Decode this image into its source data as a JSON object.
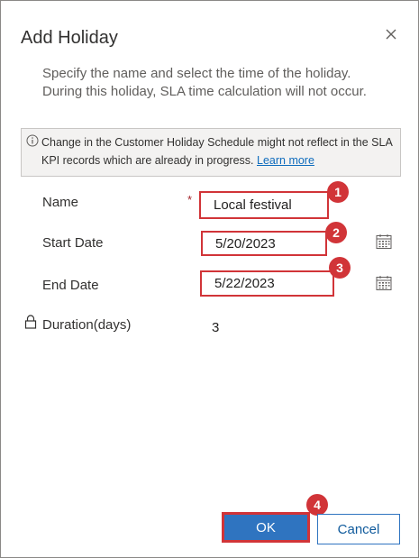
{
  "dialog": {
    "title": "Add Holiday",
    "description": "Specify the name and select the time of the holiday. During this holiday, SLA time calculation will not occur.",
    "info": {
      "text": "Change in the Customer Holiday Schedule might not reflect in the SLA KPI records which are already in progress. ",
      "link": "Learn more",
      "icon": "info-icon"
    }
  },
  "form": {
    "name": {
      "label": "Name",
      "required_marker": "*",
      "value": "Local festival"
    },
    "start_date": {
      "label": "Start Date",
      "value": "5/20/2023",
      "icon": "calendar-icon"
    },
    "end_date": {
      "label": "End Date",
      "value": "5/22/2023",
      "icon": "calendar-icon"
    },
    "duration": {
      "label": "Duration(days)",
      "value": "3",
      "icon": "lock-icon"
    }
  },
  "callouts": [
    "1",
    "2",
    "3",
    "4"
  ],
  "buttons": {
    "ok": "OK",
    "cancel": "Cancel"
  },
  "colors": {
    "highlight": "#d13438",
    "primary": "#2f74c0",
    "link": "#0f6cbd"
  }
}
